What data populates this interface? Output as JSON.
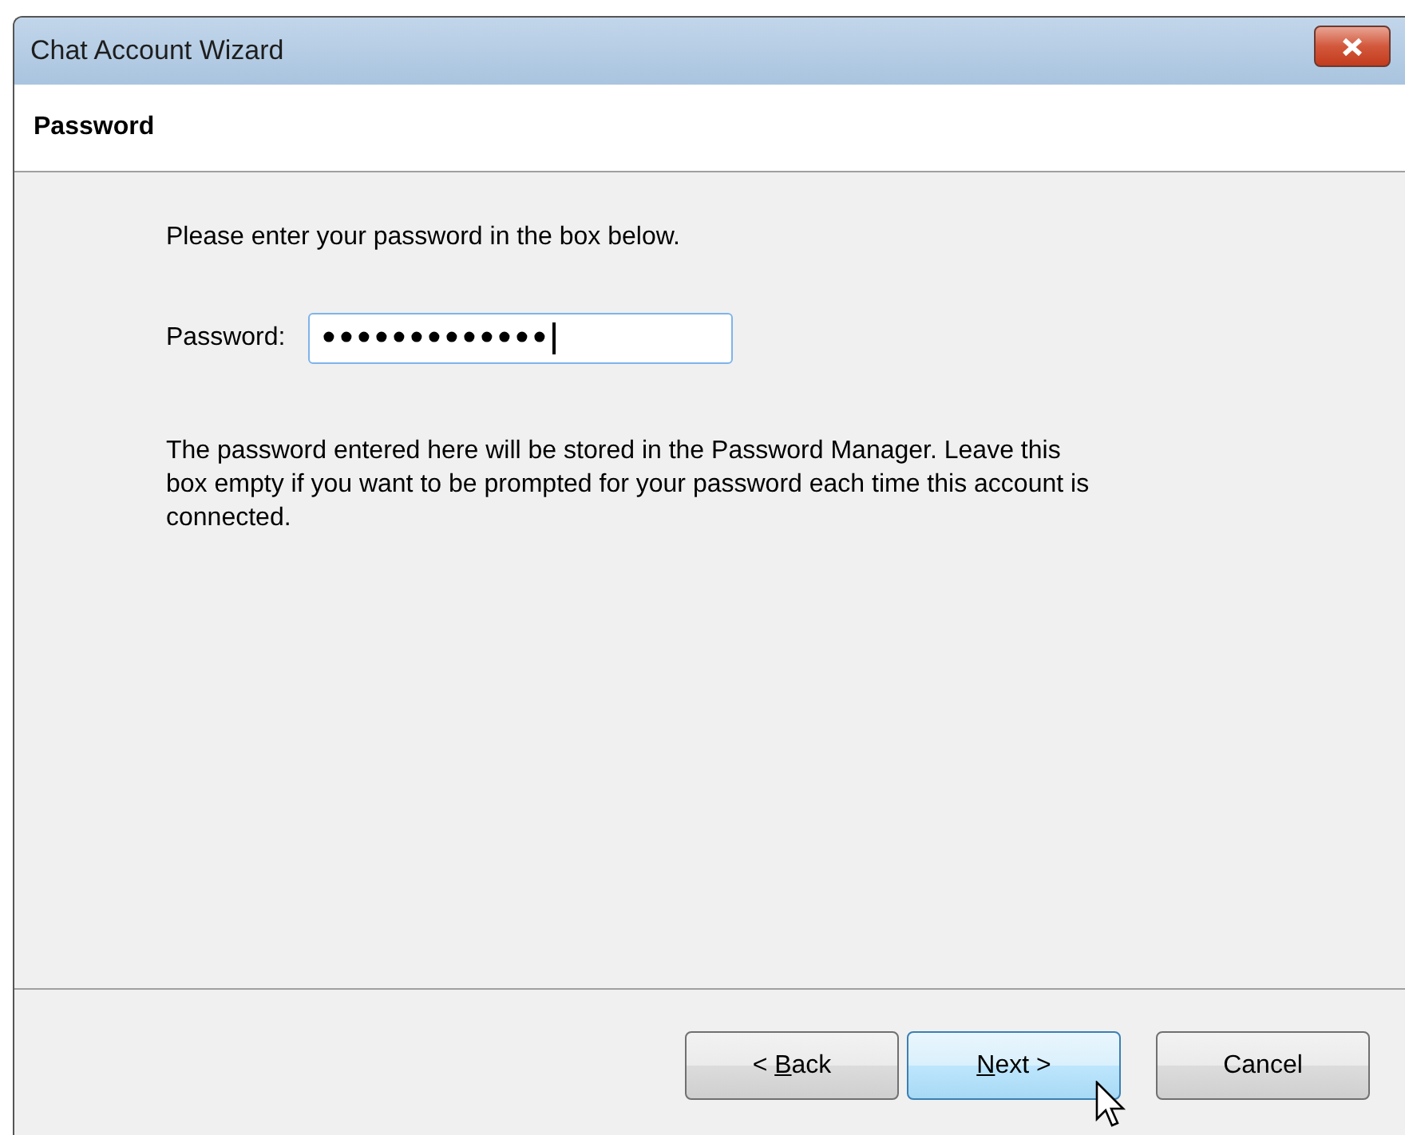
{
  "window": {
    "title": "Chat Account Wizard"
  },
  "page": {
    "heading": "Password"
  },
  "intro": "Please enter your password in the box below.",
  "password": {
    "label": "Password:",
    "value": "•••••••••••••",
    "focused": true
  },
  "note": "The password entered here will be stored in the Password Manager. Leave this box empty if you want to be prompted for your password each time this account is connected.",
  "buttons": [
    {
      "label_start": "< ",
      "mnemonic": "B",
      "label": "ack",
      "hovered": false
    },
    {
      "mnemonic": "N",
      "label": "ext >",
      "hovered": true
    },
    {
      "label": "Cancel",
      "hovered": false
    }
  ]
}
